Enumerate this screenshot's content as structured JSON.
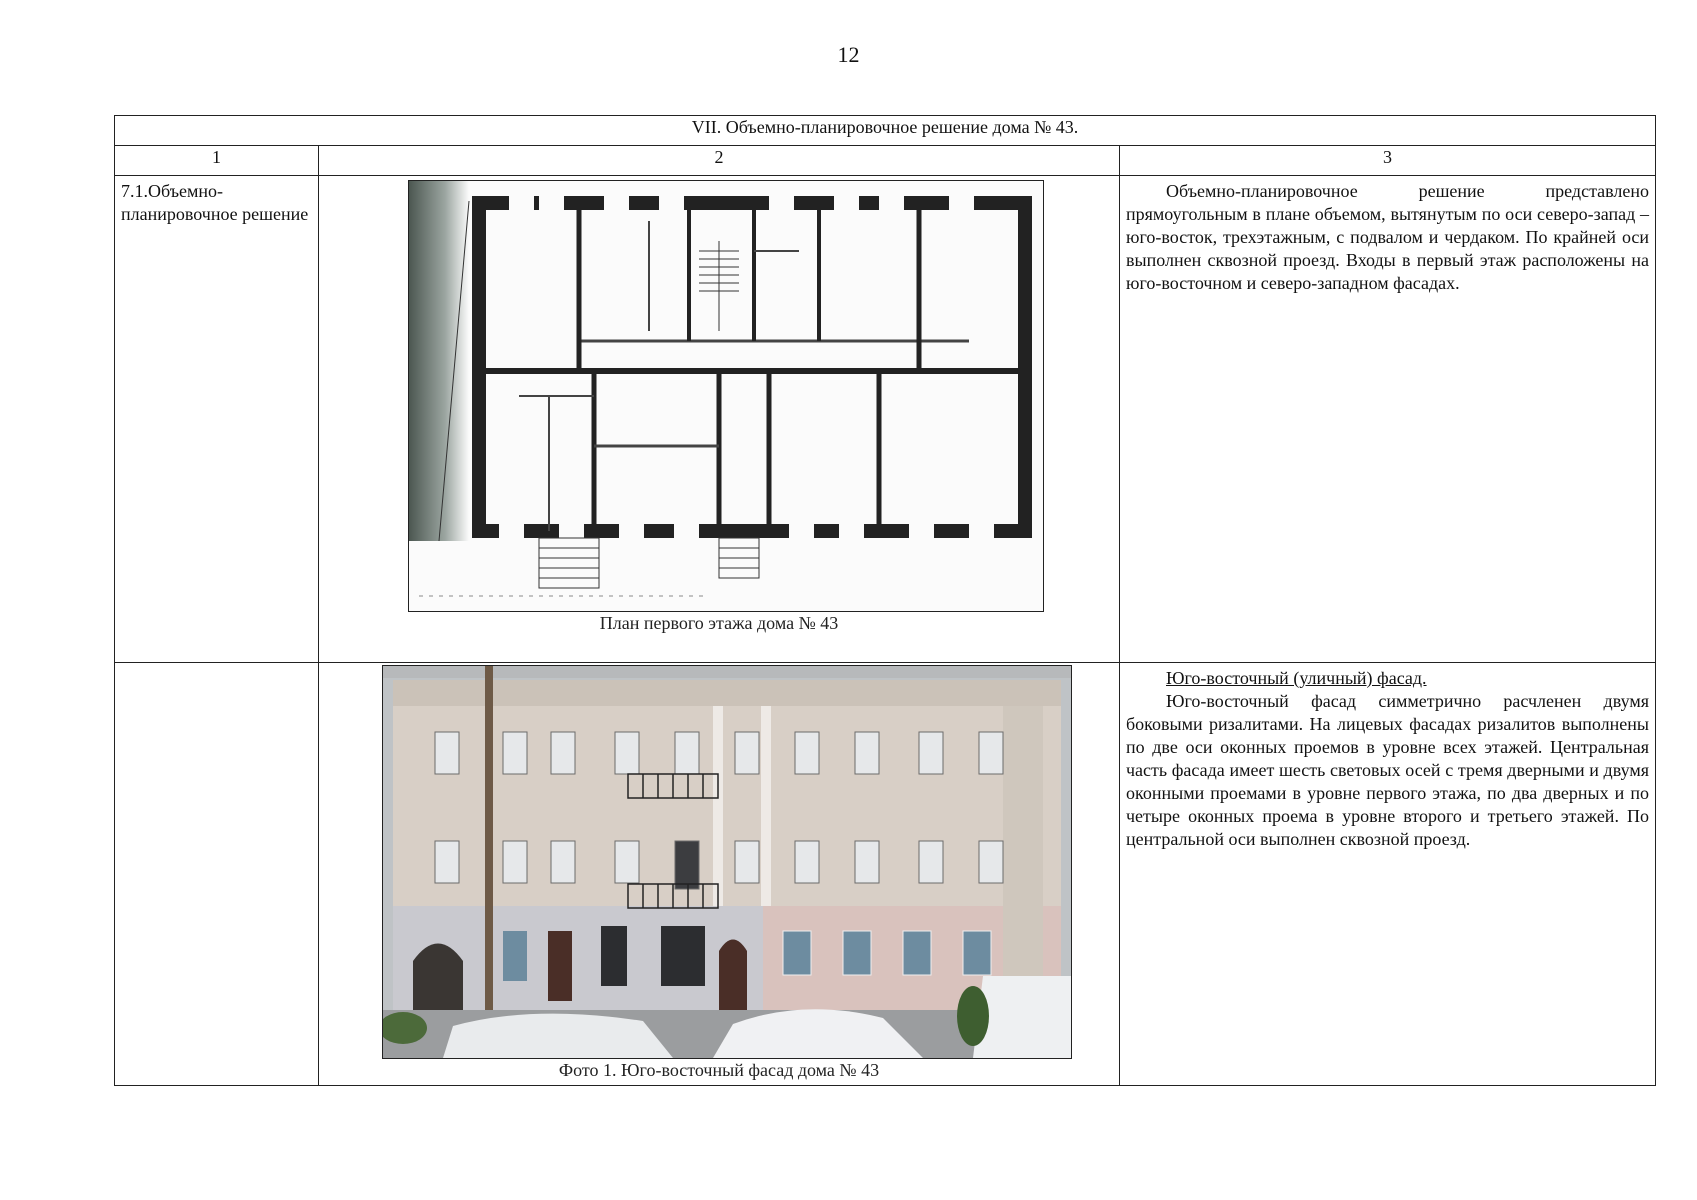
{
  "page": {
    "number": "12"
  },
  "table": {
    "title": "VII. Объемно-планировочное решение дома № 43.",
    "column_numbers": [
      "1",
      "2",
      "3"
    ],
    "rows": [
      {
        "label": "7.1.Объемно-планировочное решение",
        "image_caption": "План первого этажа дома № 43",
        "text": "Объемно-планировочное решение представлено прямоугольным в плане объемом, вытянутым по оси северо-запад – юго-восток, трехэтажным, с подвалом и чердаком. По крайней оси выполнен сквозной проезд. Входы в первый этаж расположены на юго-восточном и северо-западном фасадах."
      },
      {
        "label": "",
        "image_caption": "Фото 1. Юго-восточный фасад дома № 43",
        "heading": "Юго-восточный (уличный) фасад.",
        "text": "Юго-восточный фасад симметрично расчленен двумя боковыми ризалитами.  На лицевых фасадах ризалитов выполнены по две оси оконных проемов в уровне всех этажей. Центральная часть фасада имеет шесть световых осей с тремя дверными и двумя оконными проемами в уровне первого этажа, по два дверных и по четыре оконных проема в уровне второго и третьего этажей. По центральной оси выполнен сквозной проезд."
      }
    ]
  }
}
